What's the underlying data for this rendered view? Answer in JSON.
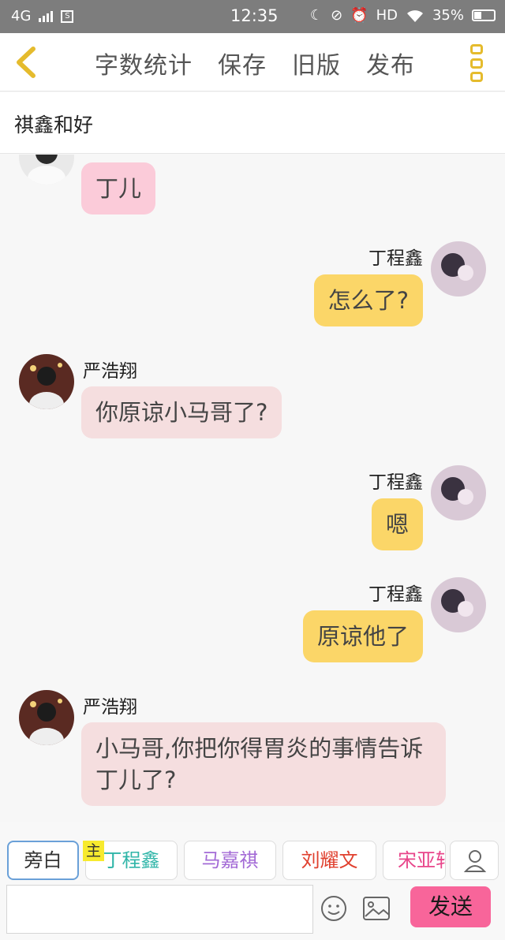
{
  "status_bar": {
    "network": "4G",
    "time": "12:35",
    "hd": "HD",
    "battery": "35%",
    "icons": [
      "signal-icon",
      "sim-icon",
      "moon-icon",
      "mute-icon",
      "alarm-icon",
      "wifi-icon",
      "battery-icon"
    ]
  },
  "toolbar": {
    "back_icon": "chevron-left-icon",
    "actions": [
      "字数统计",
      "保存",
      "旧版",
      "发布"
    ],
    "more_icon": "more-icon",
    "accent": "#e5bb2d"
  },
  "story": {
    "title": "祺鑫和好"
  },
  "messages": [
    {
      "side": "left",
      "speaker": "",
      "text": "丁儿",
      "avatar": "avatar-yan-haoxiang"
    },
    {
      "side": "right",
      "speaker": "丁程鑫",
      "text": "怎么了?",
      "avatar": "avatar-ding-chengxin"
    },
    {
      "side": "left",
      "speaker": "严浩翔",
      "text": "你原谅小马哥了?",
      "avatar": "avatar-yan-haoxiang"
    },
    {
      "side": "right",
      "speaker": "丁程鑫",
      "text": "嗯",
      "avatar": "avatar-ding-chengxin"
    },
    {
      "side": "right",
      "speaker": "丁程鑫",
      "text": "原谅他了",
      "avatar": "avatar-ding-chengxin"
    },
    {
      "side": "left",
      "speaker": "严浩翔",
      "text": "小马哥,你把你得胃炎的事情告诉丁儿了?",
      "avatar": "avatar-yan-haoxiang"
    }
  ],
  "bubble_colors": {
    "pink": "#fbcbd9",
    "rose": "#f5dedf",
    "yellow": "#fbd668"
  },
  "characters": {
    "narration": "旁白",
    "main_tag": "主",
    "list": [
      {
        "name": "丁程鑫",
        "color": "#2fb5a8"
      },
      {
        "name": "马嘉祺",
        "color": "#a36ad6"
      },
      {
        "name": "刘耀文",
        "color": "#e0402e"
      },
      {
        "name": "宋亚轩",
        "color": "#e8458a"
      }
    ],
    "user_icon": "user-icon"
  },
  "input": {
    "value": "",
    "placeholder": "",
    "emoji_icon": "emoji-icon",
    "image_icon": "image-icon",
    "send_label": "发送",
    "send_color": "#f8659a"
  }
}
